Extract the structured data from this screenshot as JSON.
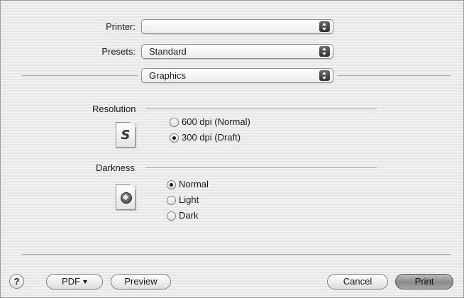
{
  "form": {
    "printer_label": "Printer:",
    "printer_value": "",
    "presets_label": "Presets:",
    "presets_value": "Standard",
    "panel_value": "Graphics"
  },
  "resolution": {
    "title": "Resolution",
    "icon_letter": "S",
    "options": [
      {
        "label": "600 dpi (Normal)",
        "selected": false
      },
      {
        "label": "300 dpi (Draft)",
        "selected": true
      }
    ]
  },
  "darkness": {
    "title": "Darkness",
    "options": [
      {
        "label": "Normal",
        "selected": true
      },
      {
        "label": "Light",
        "selected": false
      },
      {
        "label": "Dark",
        "selected": false
      }
    ]
  },
  "buttons": {
    "help": "?",
    "pdf": "PDF",
    "preview": "Preview",
    "cancel": "Cancel",
    "print": "Print"
  },
  "icons": {
    "popup_arrows": "up-down-arrows-icon",
    "resolution_doc": "document-s-icon",
    "darkness_doc": "document-globe-icon"
  }
}
